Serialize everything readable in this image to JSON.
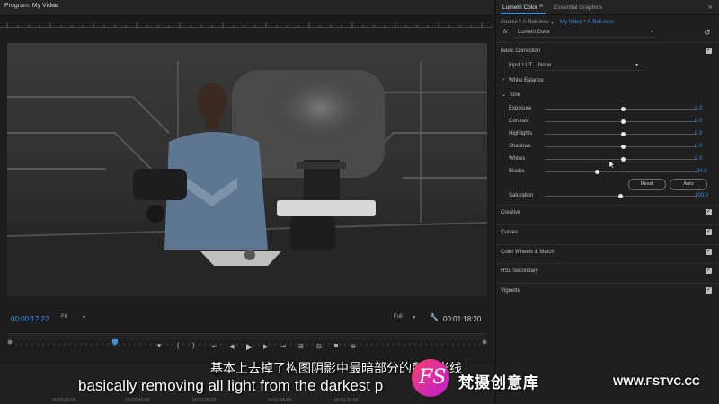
{
  "program": {
    "title": "Program: My Video",
    "menu_icon": "hamburger-icon",
    "timecode_current": "00:00:17:22",
    "fit_label": "Fit",
    "quality_label": "Full",
    "timecode_duration": "00:01:18:20",
    "timeline_ticks": [
      "00:00:30:00",
      "00:00:45:00",
      "00:01:00:00",
      "00:01:15:00",
      "00:01:30:00"
    ]
  },
  "lumetri": {
    "tab_active": "Lumetri Color",
    "tab_other": "Essential Graphics",
    "source_label": "Source * A-Roll.mov",
    "sequence_label": "My Video * A-Roll.mov",
    "fx_label": "fx",
    "effect_name": "Lumetri Color",
    "basic_correction": "Basic Correction",
    "input_lut_label": "Input LUT",
    "input_lut_value": "None",
    "white_balance": "White Balance",
    "tone": "Tone",
    "sliders": [
      {
        "label": "Exposure",
        "value": "0.0"
      },
      {
        "label": "Contrast",
        "value": "0.0"
      },
      {
        "label": "Highlights",
        "value": "0.0"
      },
      {
        "label": "Shadows",
        "value": "0.0"
      },
      {
        "label": "Whites",
        "value": "0.0"
      },
      {
        "label": "Blacks",
        "value": "-34.0"
      }
    ],
    "reset_label": "Reset",
    "auto_label": "Auto",
    "saturation_label": "Saturation",
    "saturation_value": "100.0",
    "sections": [
      "Creative",
      "Curves",
      "Color Wheels & Match",
      "HSL Secondary",
      "Vignette"
    ]
  },
  "subtitles": {
    "cn": "基本上去掉了构图阴影中最暗部分的所有光线",
    "en": "basically removing all light from the darkest p"
  },
  "watermark": {
    "logo": "FS",
    "brand": "梵摄创意库",
    "url": "WWW.FSTVC.CC"
  },
  "colors": {
    "accent": "#3f8ee8",
    "panel": "#1f1f1f"
  }
}
